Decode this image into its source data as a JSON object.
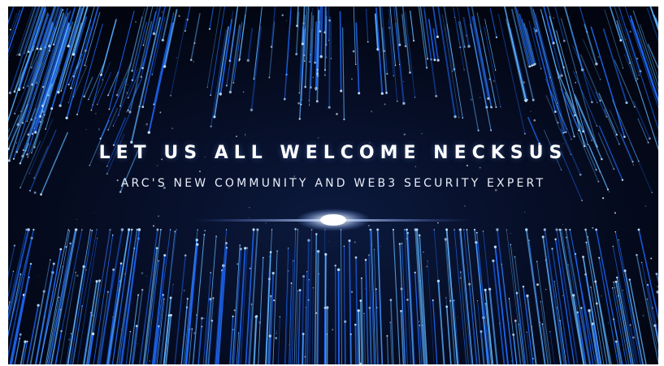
{
  "banner": {
    "headline": "LET US ALL WELCOME NECKSUS",
    "subline": "ARC'S NEW COMMUNITY AND WEB3 SECURITY EXPERT"
  },
  "colors": {
    "background": "#050b1d",
    "streak_primary": "#1e6bff",
    "streak_secondary": "#5fb4ff",
    "flare": "#ffffff",
    "text": "#ffffff"
  }
}
